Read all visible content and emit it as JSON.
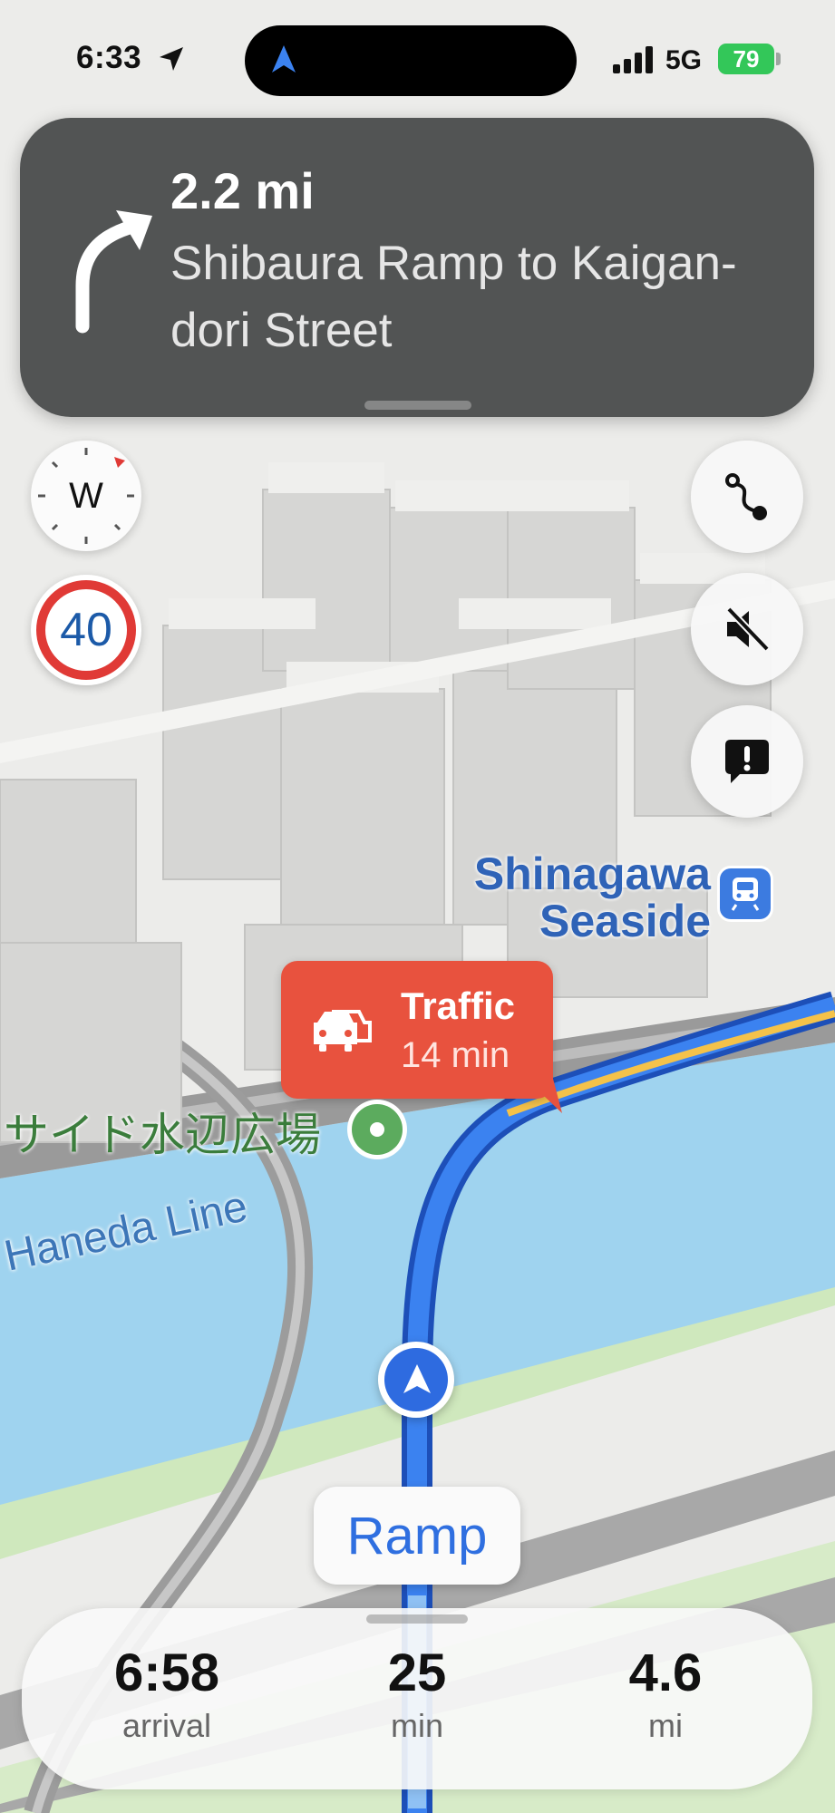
{
  "status_bar": {
    "time": "6:33",
    "network": "5G",
    "battery": "79"
  },
  "maneuver": {
    "distance": "2.2 mi",
    "instruction": "Shibaura Ramp to Kaigan-dori Street",
    "turn_icon": "turn-right-arrow-icon"
  },
  "map": {
    "compass_heading": "W",
    "speed_limit": "40",
    "station_label": "Shinagawa Seaside",
    "park_label": "サイド水辺広場",
    "line_label": "Haneda Line",
    "traffic_callout": {
      "title": "Traffic",
      "delay": "14 min"
    },
    "next_road_badge": "Ramp"
  },
  "controls": {
    "route_overview_icon": "route-icon",
    "mute_icon": "speaker-muted-icon",
    "report_icon": "report-issue-icon"
  },
  "trip_summary": {
    "arrival": {
      "value": "6:58",
      "unit": "arrival"
    },
    "duration": {
      "value": "25",
      "unit": "min"
    },
    "distance": {
      "value": "4.6",
      "unit": "mi"
    }
  },
  "colors": {
    "route": "#2e6be0",
    "traffic": "#e8523e",
    "water": "#9fd3ef",
    "banner": "#464848"
  }
}
